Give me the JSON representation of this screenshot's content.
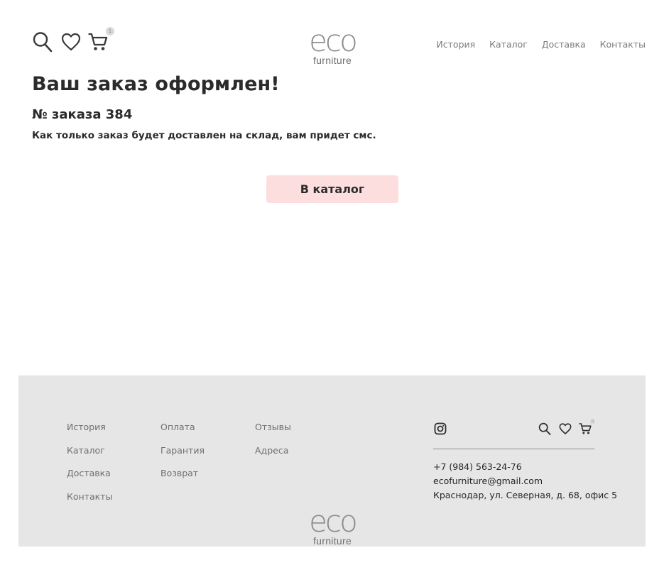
{
  "header": {
    "cart_count": "1",
    "logo": {
      "eco": "eco",
      "furniture": "furniture"
    },
    "nav": [
      {
        "label": "История"
      },
      {
        "label": "Каталог"
      },
      {
        "label": "Доставка"
      },
      {
        "label": "Контакты"
      }
    ]
  },
  "main": {
    "title": "Ваш заказ оформлен!",
    "order_number": "№ заказа 384",
    "note": "Как только заказ будет доставлен на склад, вам придет смс.",
    "catalog_button": "В каталог"
  },
  "footer": {
    "col1": [
      {
        "label": "История"
      },
      {
        "label": "Каталог"
      },
      {
        "label": "Доставка"
      },
      {
        "label": "Контакты"
      }
    ],
    "col2": [
      {
        "label": "Оплата"
      },
      {
        "label": "Гарантия"
      },
      {
        "label": "Возврат"
      }
    ],
    "col3": [
      {
        "label": "Отзывы"
      },
      {
        "label": "Адреса"
      }
    ],
    "cart_count": "0",
    "phone": "+7 (984) 563-24-76",
    "email": "ecofurniture@gmail.com",
    "address": "Краснодар, ул. Северная, д. 68, офис 5",
    "logo": {
      "eco": "eco",
      "furniture": "furniture"
    }
  },
  "icons": [
    "search-icon",
    "heart-icon",
    "cart-icon",
    "instagram-icon"
  ],
  "colors": {
    "button_bg": "#fcdede",
    "footer_bg": "#e6e6e6",
    "logo": "#8a8a8a"
  }
}
